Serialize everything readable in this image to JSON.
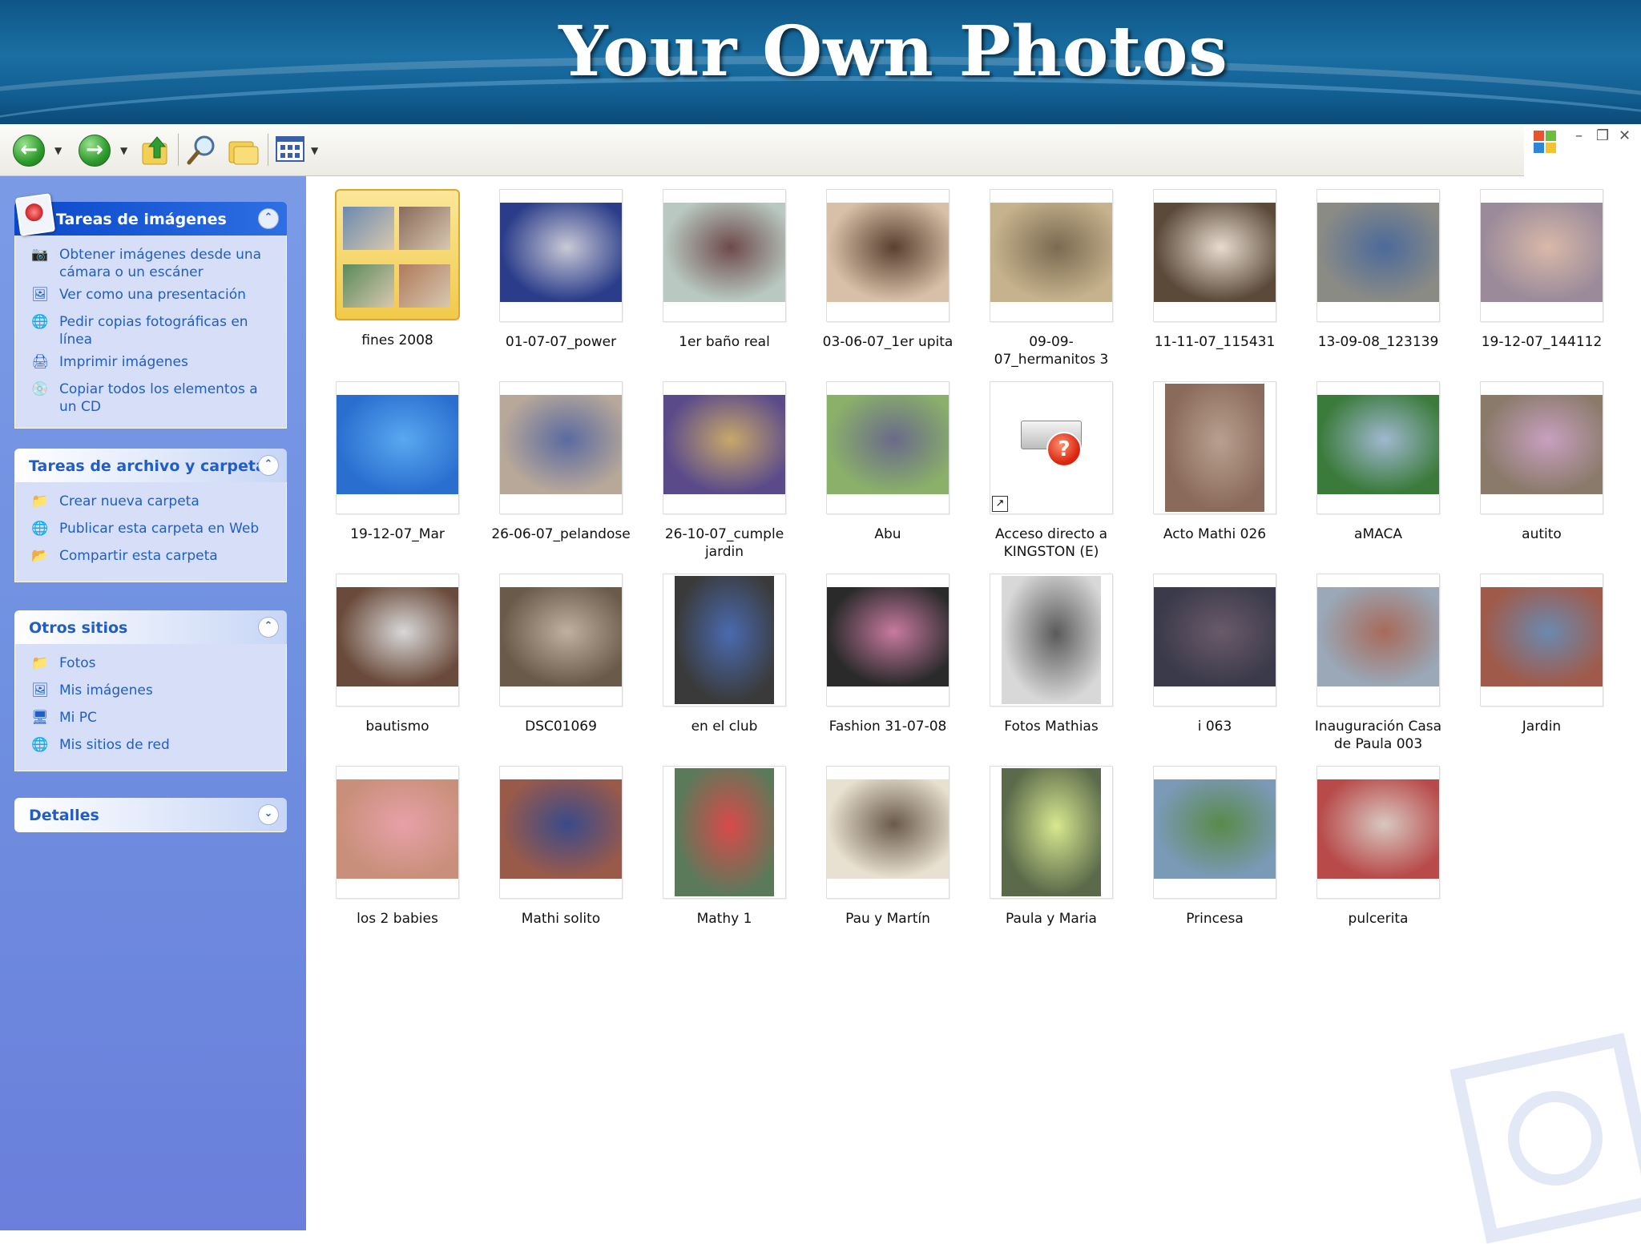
{
  "slide": {
    "title": "Your Own Photos"
  },
  "toolbar": {
    "back_icon": "back-arrow-icon",
    "forward_icon": "forward-arrow-icon",
    "up_icon": "up-folder-icon",
    "search_icon": "search-icon",
    "folders_icon": "folders-icon",
    "views_icon": "views-icon",
    "accent": "#2d9b2d"
  },
  "window_controls": {
    "minimize": "–",
    "restore": "❐",
    "close": "✕"
  },
  "taskpane": {
    "image_tasks": {
      "title": "Tareas de imágenes",
      "items": [
        {
          "label": "Obtener imágenes desde una cámara o un escáner",
          "icon": "camera-icon"
        },
        {
          "label": "Ver como una presentación",
          "icon": "slideshow-icon"
        },
        {
          "label": "Pedir copias fotográficas en línea",
          "icon": "order-prints-icon"
        },
        {
          "label": "Imprimir imágenes",
          "icon": "printer-icon"
        },
        {
          "label": "Copiar todos los elementos a un CD",
          "icon": "cd-icon"
        }
      ]
    },
    "file_tasks": {
      "title": "Tareas de archivo y carpeta",
      "items": [
        {
          "label": "Crear nueva carpeta",
          "icon": "new-folder-icon"
        },
        {
          "label": "Publicar esta carpeta en Web",
          "icon": "globe-icon"
        },
        {
          "label": "Compartir esta carpeta",
          "icon": "share-folder-icon"
        }
      ]
    },
    "other_places": {
      "title": "Otros sitios",
      "items": [
        {
          "label": "Fotos",
          "icon": "folder-icon"
        },
        {
          "label": "Mis imágenes",
          "icon": "my-pictures-icon"
        },
        {
          "label": "Mi PC",
          "icon": "computer-icon"
        },
        {
          "label": "Mis sitios de red",
          "icon": "network-icon"
        }
      ]
    },
    "details": {
      "title": "Detalles"
    }
  },
  "files": [
    {
      "name": "fines 2008",
      "kind": "folder"
    },
    {
      "name": "01-07-07_power",
      "kind": "photo"
    },
    {
      "name": "1er baño real",
      "kind": "photo"
    },
    {
      "name": "03-06-07_1er upita",
      "kind": "photo"
    },
    {
      "name": "09-09-07_hermanitos 3",
      "kind": "photo"
    },
    {
      "name": "11-11-07_115431",
      "kind": "photo"
    },
    {
      "name": "13-09-08_123139",
      "kind": "photo"
    },
    {
      "name": "19-12-07_144112",
      "kind": "photo"
    },
    {
      "name": "19-12-07_Mar",
      "kind": "photo"
    },
    {
      "name": "26-06-07_pelandose",
      "kind": "photo"
    },
    {
      "name": "26-10-07_cumple jardin",
      "kind": "photo"
    },
    {
      "name": "Abu",
      "kind": "photo"
    },
    {
      "name": "Acceso directo a KINGSTON (E)",
      "kind": "shortcut"
    },
    {
      "name": "Acto Mathi 026",
      "kind": "photo"
    },
    {
      "name": "aMACA",
      "kind": "photo"
    },
    {
      "name": "autito",
      "kind": "photo"
    },
    {
      "name": "bautismo",
      "kind": "photo"
    },
    {
      "name": "DSC01069",
      "kind": "photo"
    },
    {
      "name": "en el club",
      "kind": "photo"
    },
    {
      "name": "Fashion 31-07-08",
      "kind": "photo"
    },
    {
      "name": "Fotos Mathias",
      "kind": "photo"
    },
    {
      "name": "i 063",
      "kind": "photo"
    },
    {
      "name": "Inauguración Casa de Paula 003",
      "kind": "photo"
    },
    {
      "name": "Jardin",
      "kind": "photo"
    },
    {
      "name": "los 2 babies",
      "kind": "photo"
    },
    {
      "name": "Mathi solito",
      "kind": "photo"
    },
    {
      "name": "Mathy 1",
      "kind": "photo"
    },
    {
      "name": "Pau y Martín",
      "kind": "photo"
    },
    {
      "name": "Paula y Maria",
      "kind": "photo"
    },
    {
      "name": "Princesa",
      "kind": "photo"
    },
    {
      "name": "pulcerita",
      "kind": "photo"
    }
  ]
}
